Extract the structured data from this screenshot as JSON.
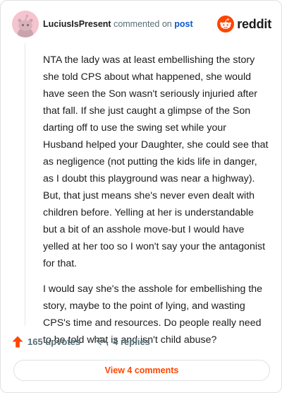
{
  "comment": {
    "author": "LuciusIsPresent",
    "verb": "commented on",
    "target": "post",
    "paragraphs": [
      "NTA the lady was at least embellishing the story she told CPS about what happened, she would have seen the Son wasn't seriously injuried after that fall. If she just caught a glimpse of the Son darting off to use the swing set while your Husband helped your Daughter, she could see that as negligence (not putting the kids life in danger, as I doubt this playground was near a highway). But, that just means she's never even dealt with children before. Yelling at her is understandable but a bit of an asshole move-but I would have yelled at her too so I won't say your the antagonist for that.",
      "I would say she's the asshole for embellishing the story, maybe to the point of lying, and wasting CPS's time and resources. Do people really need to be told what is and isn't child abuse?"
    ],
    "upvotes": "165 upvotes",
    "replies": "4 replies",
    "view_comments": "View 4 comments"
  },
  "brand": {
    "wordmark": "reddit",
    "logo_icon": "reddit-snoo-icon",
    "accent": "#ff4500"
  },
  "icons": {
    "upvote": "upvote-arrow-icon",
    "reply": "reply-arrow-icon",
    "avatar": "snoo-avatar-icon"
  },
  "colors": {
    "link": "#0a57d0",
    "muted": "#576f76",
    "avatar_bg": "#f4c4cf"
  }
}
